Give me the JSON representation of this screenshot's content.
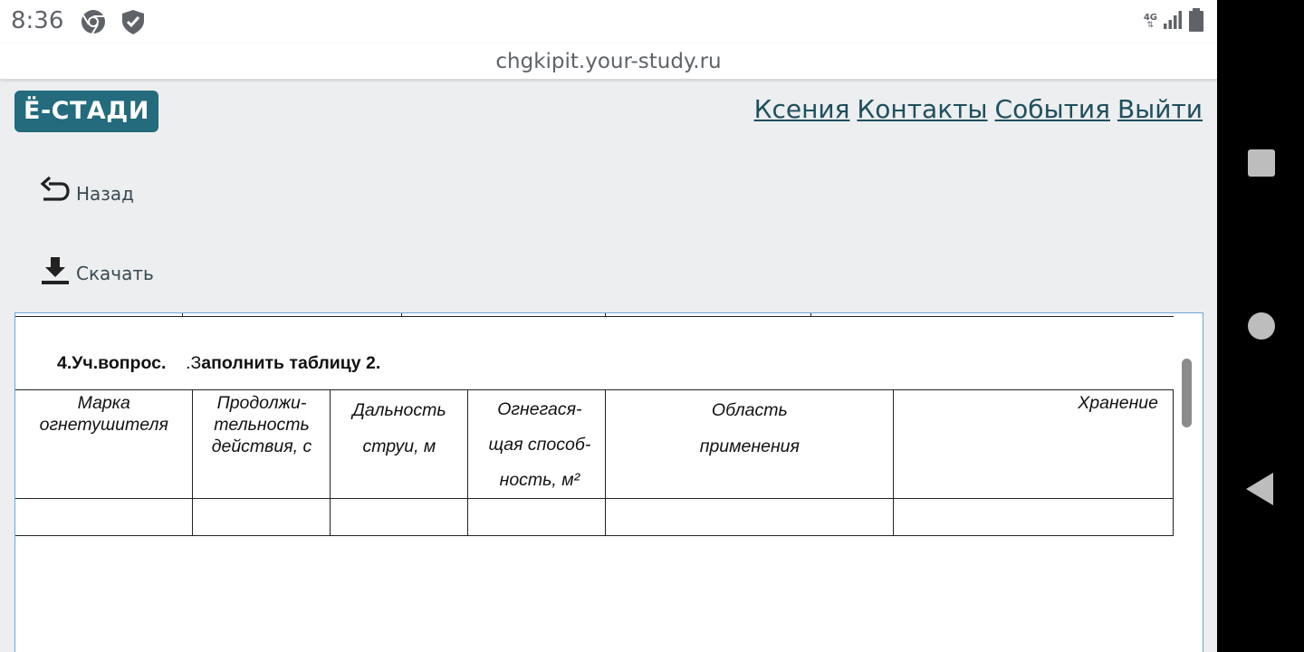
{
  "status_bar": {
    "time": "8:36",
    "icons_left": [
      "chrome-icon",
      "shield-check-icon"
    ],
    "network": "4G",
    "icons_right": [
      "network-4g-icon",
      "signal-icon",
      "battery-icon"
    ]
  },
  "browser": {
    "url": "chgkipit.your-study.ru"
  },
  "header": {
    "logo": "Ё-СТАДИ",
    "nav": [
      {
        "label": "Ксения"
      },
      {
        "label": "Контакты"
      },
      {
        "label": "События"
      },
      {
        "label": "Выйти"
      }
    ]
  },
  "actions": {
    "back_label": "Назад",
    "download_label": "Скачать"
  },
  "document": {
    "heading_prefix": "4.Уч.вопрос.",
    "heading_dot": ".З",
    "heading_text": "аполнить таблицу 2.",
    "table": {
      "headers": [
        "Марка огнетушителя",
        "Продолжи-тельность действия, с",
        "Дальность струи, м",
        "Огнегася-щая способ-ность, м²",
        "Область применения",
        "Хранение"
      ],
      "rows": [
        [
          "",
          "",
          "",
          "",
          "",
          ""
        ]
      ]
    }
  },
  "colors": {
    "logo_bg": "#236b7d",
    "link": "#1f4f5e",
    "page_bg": "#eceeef",
    "frame_border": "#6ca7d8"
  }
}
